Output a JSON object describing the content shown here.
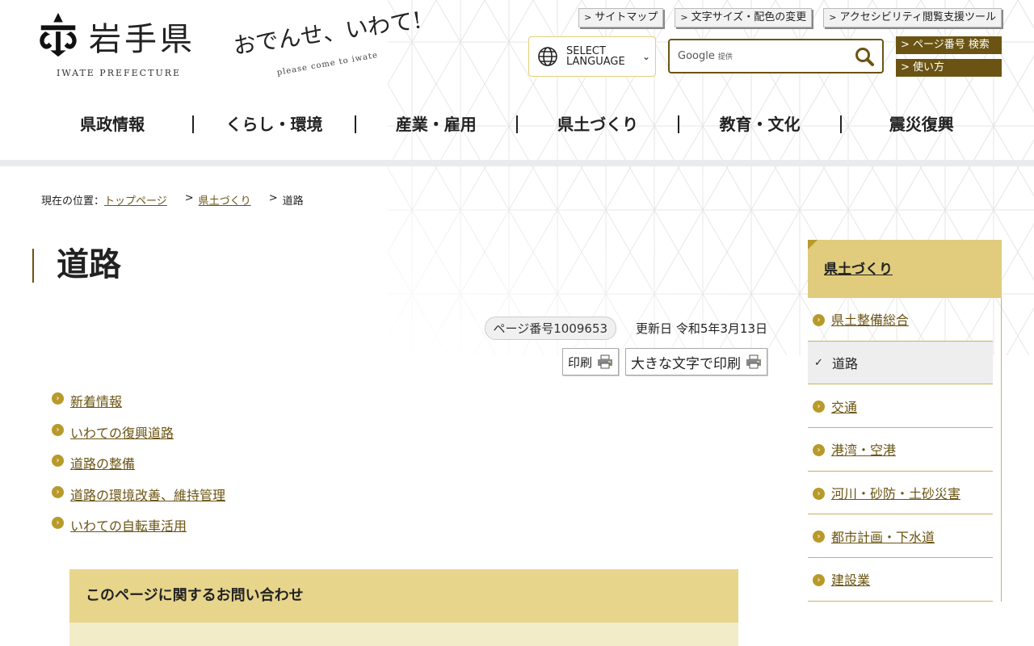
{
  "header": {
    "logo_name": "岩手県",
    "logo_en": "IWATE PREFECTURE",
    "catch_main": "おでんせ、いわて!",
    "catch_sub": "please come to iwate",
    "util_links": [
      "サイトマップ",
      "文字サイズ・配色の変更",
      "アクセシビリティ閲覧支援ツール"
    ],
    "language_label": "SELECT LANGUAGE",
    "search_placeholder_brand": "Google",
    "search_placeholder_suffix": "提供",
    "page_search_label": "ページ番号 検索",
    "howto_label": "使い方"
  },
  "nav": {
    "items": [
      "県政情報",
      "くらし・環境",
      "産業・雇用",
      "県土づくり",
      "教育・文化",
      "震災復興"
    ]
  },
  "breadcrumb": {
    "prefix": "現在の位置：",
    "items": [
      "トップページ",
      "県土づくり",
      "道路"
    ]
  },
  "main": {
    "title": "道路",
    "page_number": "ページ番号1009653",
    "updated": "更新日 令和5年3月13日",
    "print_label": "印刷",
    "print_large_label": "大きな文字で印刷",
    "links": [
      "新着情報",
      "いわての復興道路",
      "道路の整備",
      "道路の環境改善、維持管理",
      "いわての自転車活用"
    ],
    "contact_heading": "このページに関するお問い合わせ"
  },
  "side": {
    "heading": "県土づくり",
    "items": [
      "県土整備総合",
      "道路",
      "交通",
      "港湾・空港",
      "河川・砂防・土砂災害",
      "都市計画・下水道",
      "建設業"
    ],
    "current_index": 1
  },
  "colors": {
    "accent_brown": "#6b5413",
    "gold": "#b89a2a",
    "side_head_bg": "#e0cc7c",
    "contact_bg": "#e7d58c"
  }
}
